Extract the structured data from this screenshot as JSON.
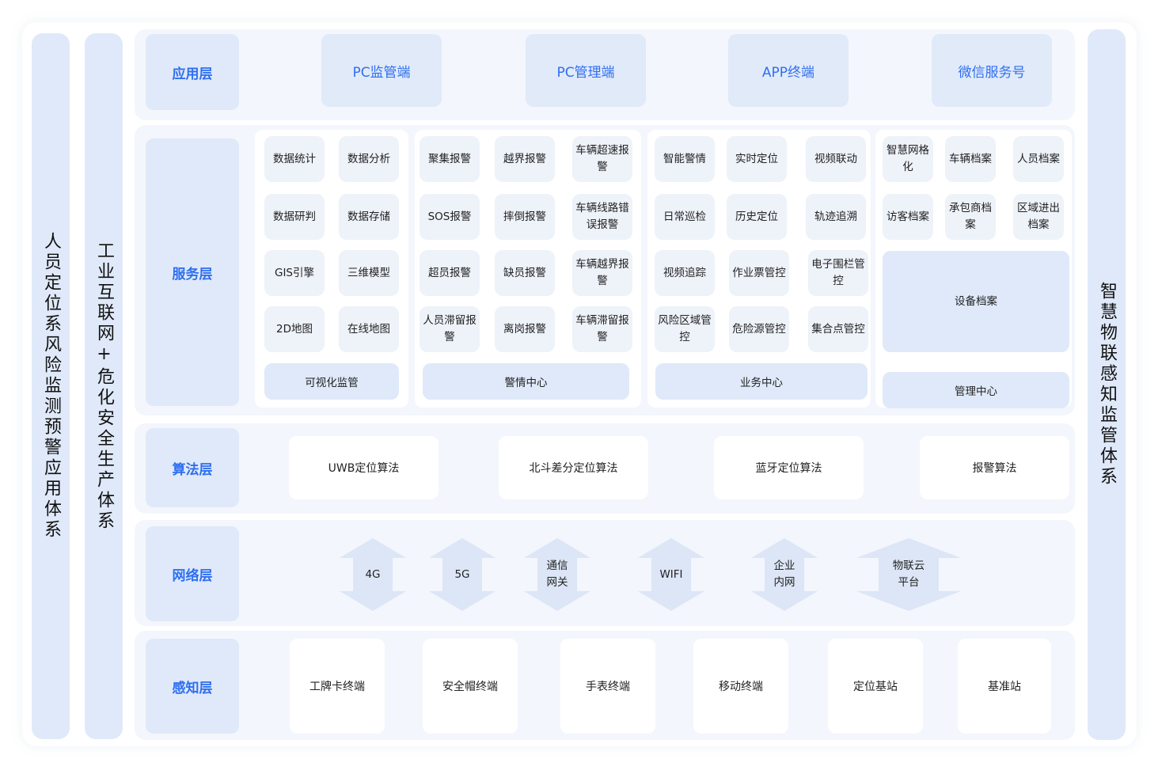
{
  "left_titles": [
    "人员定位系风险监测预警应用体系",
    "工业互联网+危化安全生产体系"
  ],
  "right_title": "智慧物联感知监管体系",
  "layers": {
    "application": "应用层",
    "service": "服务层",
    "algorithm": "算法层",
    "network": "网络层",
    "perception": "感知层"
  },
  "application_items": [
    "PC监管端",
    "PC管理端",
    "APP终端",
    "微信服务号"
  ],
  "service_panels": [
    {
      "footer": "可视化监管",
      "items": [
        "数据统计",
        "数据分析",
        "数据研判",
        "数据存储",
        "GIS引擎",
        "三维模型",
        "2D地图",
        "在线地图"
      ]
    },
    {
      "footer": "警情中心",
      "items": [
        "聚集报警",
        "越界报警",
        "车辆超速报警",
        "SOS报警",
        "摔倒报警",
        "车辆线路错误报警",
        "超员报警",
        "缺员报警",
        "车辆越界报警",
        "人员滞留报警",
        "离岗报警",
        "车辆滞留报警"
      ]
    },
    {
      "footer": "业务中心",
      "items": [
        "智能警情",
        "实时定位",
        "视频联动",
        "日常巡检",
        "历史定位",
        "轨迹追溯",
        "视频追踪",
        "作业票管控",
        "电子围栏管控",
        "风险区域管控",
        "危险源管控",
        "集合点管控"
      ]
    },
    {
      "footer": "管理中心",
      "items": [
        "智慧网格化",
        "车辆档案",
        "人员档案",
        "访客档案",
        "承包商档案",
        "区域进出档案"
      ],
      "big": "设备档案"
    }
  ],
  "algorithm_items": [
    "UWB定位算法",
    "北斗差分定位算法",
    "蓝牙定位算法",
    "报警算法"
  ],
  "network_items": [
    "4G",
    "5G",
    "通信网关",
    "WIFI",
    "企业内网",
    "物联云平台"
  ],
  "perception_items": [
    "工牌卡终端",
    "安全帽终端",
    "手表终端",
    "移动终端",
    "定位基站",
    "基准站"
  ],
  "colors": {
    "accent": "#2f6ff0",
    "tag_bg": "#dfe9f9",
    "band_bg": "#f3f6fc",
    "cell_bg": "#eef2f9",
    "arrow": "#dce6f6"
  }
}
